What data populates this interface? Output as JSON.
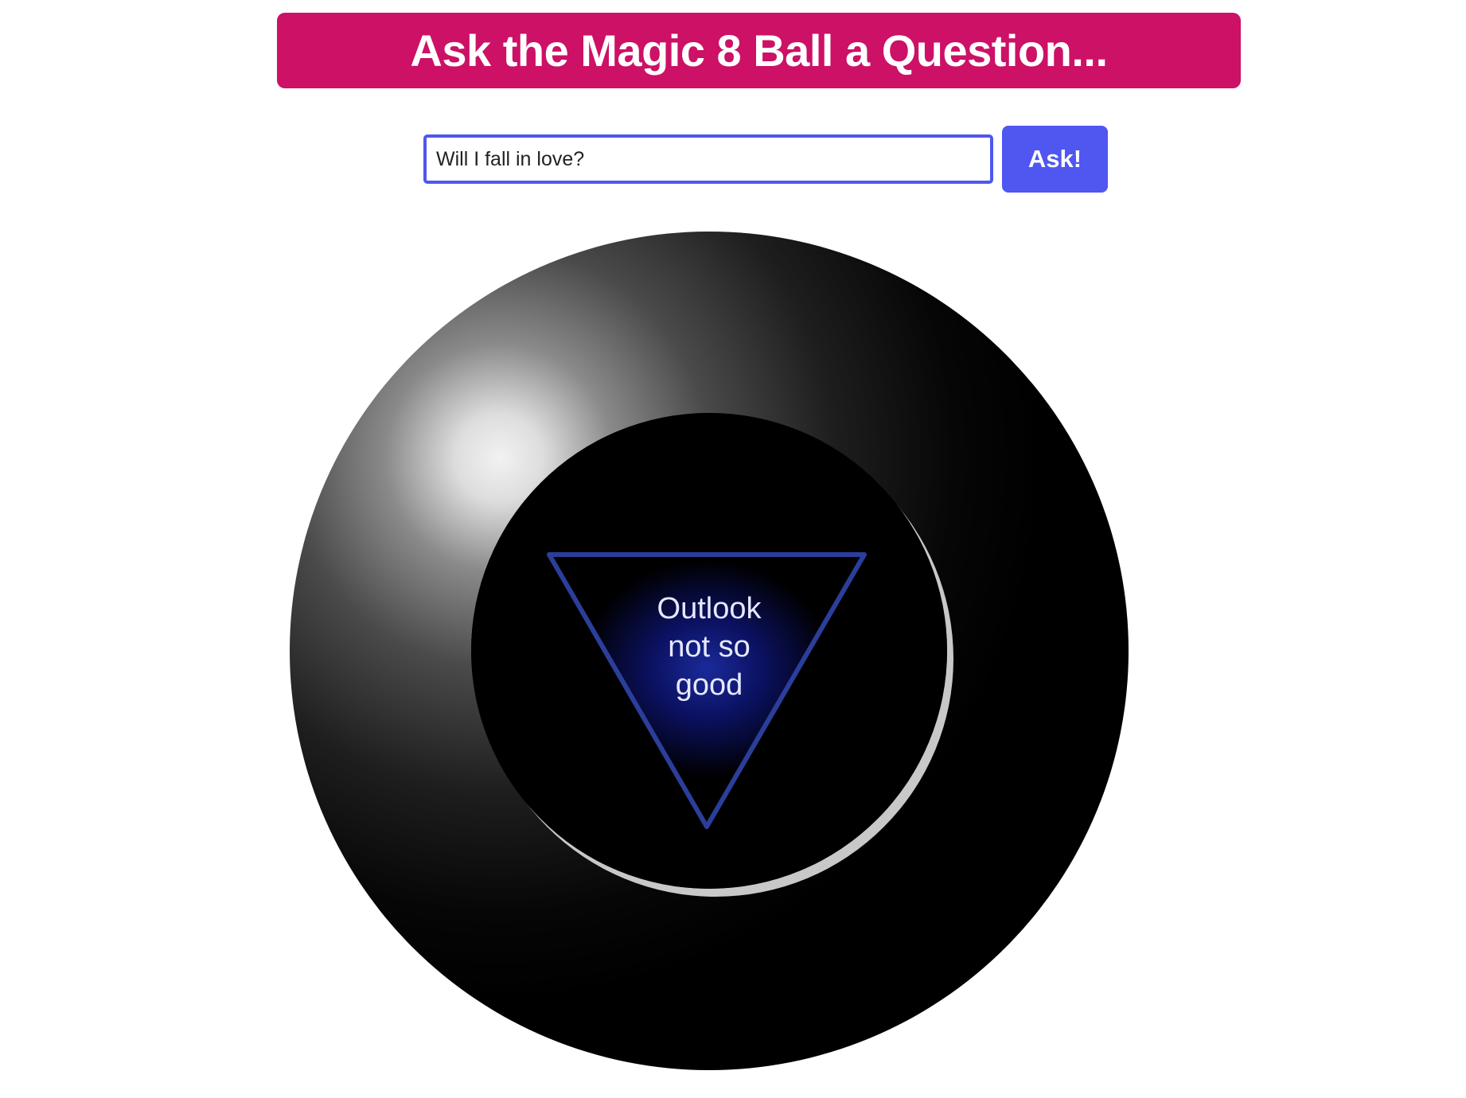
{
  "header": {
    "title": "Ask the Magic 8 Ball a Question..."
  },
  "question": {
    "value": "Will I fall in love?"
  },
  "ask_button": {
    "label": "Ask!"
  },
  "ball": {
    "answer": "Outlook not so good"
  },
  "colors": {
    "header_bg": "#cc1166",
    "accent": "#5056f0",
    "triangle_stroke": "#2b3e9a",
    "ball": "#000000"
  }
}
